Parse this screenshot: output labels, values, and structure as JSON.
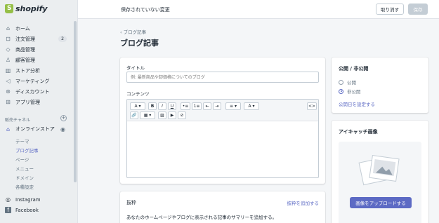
{
  "brand": {
    "name": "shopify",
    "accent": "#5c6ac4",
    "logo_green": "#95bf47"
  },
  "sidebar": {
    "items": [
      {
        "label": "ホーム",
        "icon": "home-icon"
      },
      {
        "label": "注文管理",
        "icon": "orders-icon",
        "badge": "2"
      },
      {
        "label": "商品管理",
        "icon": "tag-icon"
      },
      {
        "label": "顧客管理",
        "icon": "person-icon"
      },
      {
        "label": "ストア分析",
        "icon": "bar-chart-icon"
      },
      {
        "label": "マーケティング",
        "icon": "megaphone-icon"
      },
      {
        "label": "ディスカウント",
        "icon": "discount-icon"
      },
      {
        "label": "アプリ管理",
        "icon": "apps-icon"
      }
    ],
    "channels_title": "販売チャネル",
    "online_store": "オンラインストア",
    "sub_items": [
      "テーマ",
      "ブログ記事",
      "ページ",
      "メニュー",
      "ドメイン",
      "各種設定"
    ],
    "active_sub": "ブログ記事",
    "bottom": [
      {
        "label": "Instagram",
        "icon": "instagram-icon"
      },
      {
        "label": "Facebook",
        "icon": "facebook-icon"
      }
    ]
  },
  "topbar": {
    "unsaved": "保存されていない変更",
    "cancel": "取り消す",
    "save": "保存"
  },
  "page": {
    "breadcrumb": "ブログ記事",
    "title": "ブログ記事"
  },
  "form": {
    "title_label": "タイトル",
    "title_placeholder": "例: 最新商品や卸価格についてのブログ",
    "content_label": "コンテンツ"
  },
  "toolbar": {
    "row1": [
      "A ▾",
      "B",
      "I",
      "U",
      "•≡",
      "1≡",
      "⇤",
      "⇥",
      "≡ ▾",
      "A ▾",
      "<>"
    ],
    "row2": [
      "🔗",
      "▦ ▾",
      "▨",
      "▶",
      "⊘"
    ]
  },
  "excerpt": {
    "title": "抜粋",
    "link": "抜粋を追加する",
    "text": "あなたのホームページやブログに表示される記事のサマリーを追加する。"
  },
  "visibility": {
    "title": "公開 / 非公開",
    "options": [
      "公開",
      "非公開"
    ],
    "selected": "非公開",
    "link": "公開日を設定する"
  },
  "featured_image": {
    "title": "アイキャッチ画像",
    "upload": "画像をアップロードする"
  }
}
